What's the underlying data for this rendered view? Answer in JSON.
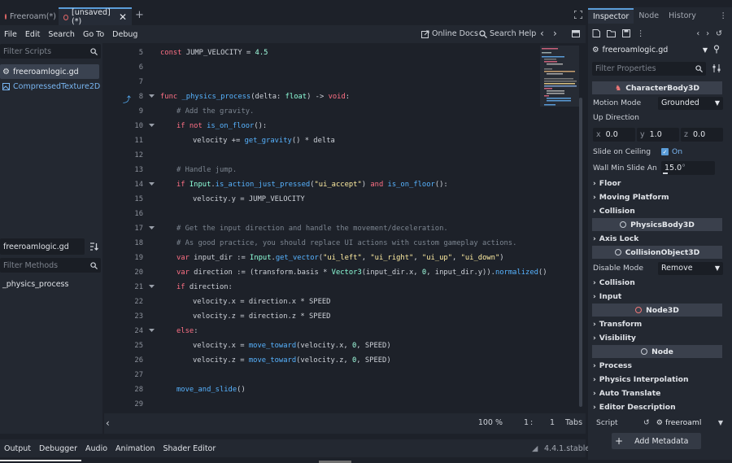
{
  "tabs": [
    {
      "label": "Freeroam(*)",
      "active": false
    },
    {
      "label": "[unsaved](*)",
      "active": true
    }
  ],
  "menu": [
    "File",
    "Edit",
    "Search",
    "Go To",
    "Debug"
  ],
  "toolbar": {
    "online_docs": "Online Docs",
    "search_help": "Search Help"
  },
  "scripts": {
    "filter_placeholder": "Filter Scripts",
    "items": [
      "freeroamlogic.gd",
      "CompressedTexture2D"
    ],
    "current_script": "freeroamlogic.gd",
    "methods_placeholder": "Filter Methods",
    "methods": [
      "_physics_process"
    ]
  },
  "editor": {
    "line_numbers": [
      "5",
      "6",
      "7",
      "8",
      "9",
      "10",
      "11",
      "12",
      "13",
      "14",
      "15",
      "16",
      "17",
      "18",
      "19",
      "20",
      "21",
      "22",
      "23",
      "24",
      "25",
      "26",
      "27",
      "28",
      "29"
    ],
    "status": {
      "zoom": "100 %",
      "line": "1",
      "col": "1",
      "indent": "Tabs"
    }
  },
  "bottom_tabs": [
    "Output",
    "Debugger",
    "Audio",
    "Animation",
    "Shader Editor"
  ],
  "version": "4.4.1.stable",
  "inspector": {
    "tabs": [
      "Inspector",
      "Node",
      "History"
    ],
    "resource": "freeroamlogic.gd",
    "filter_placeholder": "Filter Properties",
    "class_characterbody": "CharacterBody3D",
    "motion_mode_label": "Motion Mode",
    "motion_mode_value": "Grounded",
    "up_direction_label": "Up Direction",
    "up_x": "0.0",
    "up_y": "1.0",
    "up_z": "0.0",
    "axis_x": "x",
    "axis_y": "y",
    "axis_z": "z",
    "slide_ceiling_label": "Slide on Ceiling",
    "slide_ceiling_value": "On",
    "wall_min_label": "Wall Min Slide An",
    "wall_min_value": "15.0",
    "wall_min_unit": "°",
    "sections_a": [
      "Floor",
      "Moving Platform",
      "Collision"
    ],
    "class_physicsbody": "PhysicsBody3D",
    "sections_b": [
      "Axis Lock"
    ],
    "class_collisionobject": "CollisionObject3D",
    "disable_mode_label": "Disable Mode",
    "disable_mode_value": "Remove",
    "sections_c": [
      "Collision",
      "Input"
    ],
    "class_node3d": "Node3D",
    "sections_d": [
      "Transform",
      "Visibility"
    ],
    "class_node": "Node",
    "sections_e": [
      "Process",
      "Physics Interpolation",
      "Auto Translate",
      "Editor Description"
    ],
    "script_label": "Script",
    "script_value": "freeroaml",
    "add_metadata": "Add Metadata"
  },
  "colors": {
    "accent": "#5b9dd9",
    "keyword": "#ff7085",
    "function": "#57b3ff",
    "string": "#ffeda1",
    "number": "#a1ffe0",
    "comment": "#7c8590"
  }
}
